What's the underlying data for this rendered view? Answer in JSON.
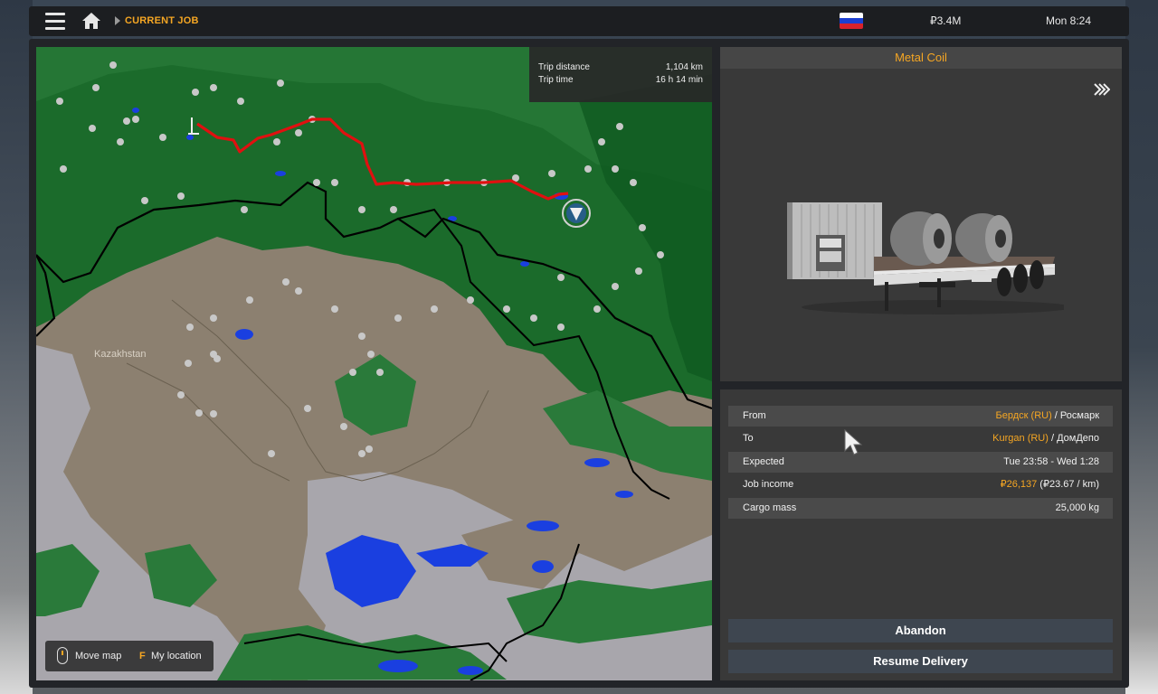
{
  "topbar": {
    "breadcrumb": "CURRENT JOB",
    "money": "₽3.4M",
    "clock": "Mon 8:24",
    "flag": {
      "colors": [
        "#ffffff",
        "#1c3fd1",
        "#d8222b"
      ]
    }
  },
  "map": {
    "region_label": "Kazakhstan",
    "trip": {
      "distance_label": "Trip distance",
      "distance_value": "1,104 km",
      "time_label": "Trip time",
      "time_value": "16 h 14 min"
    },
    "hints": {
      "move_label": "Move map",
      "location_key": "F",
      "location_label": "My location"
    },
    "colors": {
      "forest": "#1b6b2b",
      "steppe": "#8c8070",
      "water": "#1a3fe0",
      "route": "#e01010"
    }
  },
  "cargo": {
    "name": "Metal Coil"
  },
  "job": {
    "from_label": "From",
    "from_city": "Бердск (RU)",
    "from_company": " / Росмарк",
    "to_label": "To",
    "to_city": "Kurgan (RU)",
    "to_company": " / ДомДепо",
    "expected_label": "Expected",
    "expected_value": "Tue 23:58 - Wed 1:28",
    "income_label": "Job income",
    "income_value": "₽26,137",
    "income_rate": " (₽23.67 / km)",
    "mass_label": "Cargo mass",
    "mass_value": "25,000 kg"
  },
  "buttons": {
    "abandon": "Abandon",
    "resume": "Resume Delivery"
  }
}
